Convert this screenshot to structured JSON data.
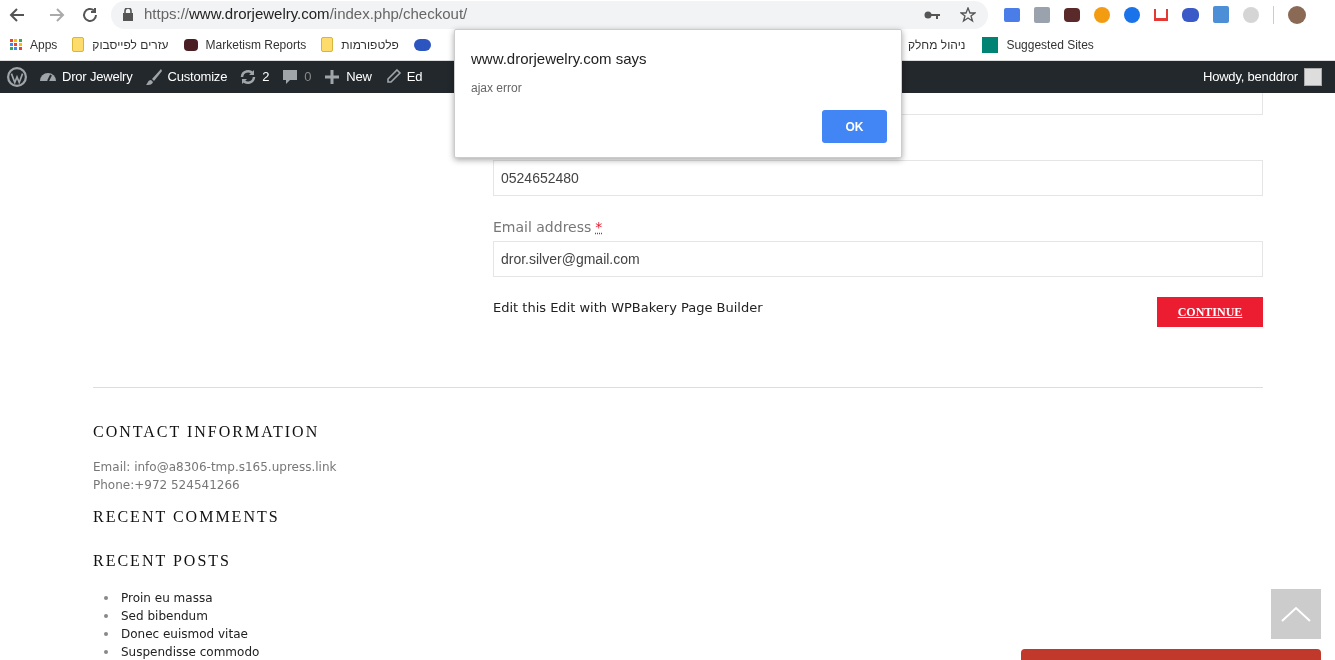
{
  "browser": {
    "url_scheme": "https://",
    "url_host": "www.drorjewelry.com",
    "url_path": "/index.php/checkout/",
    "bookmarks": [
      {
        "kind": "apps",
        "label": "Apps"
      },
      {
        "kind": "folder",
        "label": "עזרים לפייסבוק"
      },
      {
        "kind": "site",
        "label": "Marketism Reports"
      },
      {
        "kind": "folder",
        "label": "פלטפורמות"
      },
      {
        "kind": "face"
      },
      {
        "kind": "plain",
        "label": "ניהול מחלק"
      },
      {
        "kind": "bing",
        "label": "Suggested Sites"
      }
    ]
  },
  "admin_bar": {
    "items": [
      {
        "kind": "wp"
      },
      {
        "kind": "dashboard",
        "label": "Dror Jewelry"
      },
      {
        "kind": "brush",
        "label": "Customize"
      },
      {
        "kind": "updates",
        "label": "2"
      },
      {
        "kind": "comments",
        "label": "0"
      },
      {
        "kind": "new",
        "label": "New"
      },
      {
        "kind": "edit",
        "label": "Ed"
      }
    ],
    "account": "Howdy, benddror"
  },
  "form": {
    "phone_value": "0524652480",
    "email_label": "Email address",
    "required_mark": "*",
    "email_value": "dror.silver@gmail.com",
    "edit_links": "Edit this Edit with WPBakery Page Builder",
    "continue": "CONTINUE"
  },
  "footer": {
    "contact_title": "CONTACT INFORMATION",
    "contact_lines": [
      "Email: info@a8306-tmp.s165.upress.link",
      "Phone:+972 524541266"
    ],
    "comments_title": "RECENT COMMENTS",
    "posts_title": "RECENT POSTS",
    "posts": [
      "Proin eu massa",
      "Sed bibendum",
      "Donec euismod vitae",
      "Suspendisse commodo"
    ]
  },
  "dialog": {
    "title": "www.drorjewelry.com says",
    "message": "ajax error",
    "ok": "OK"
  }
}
